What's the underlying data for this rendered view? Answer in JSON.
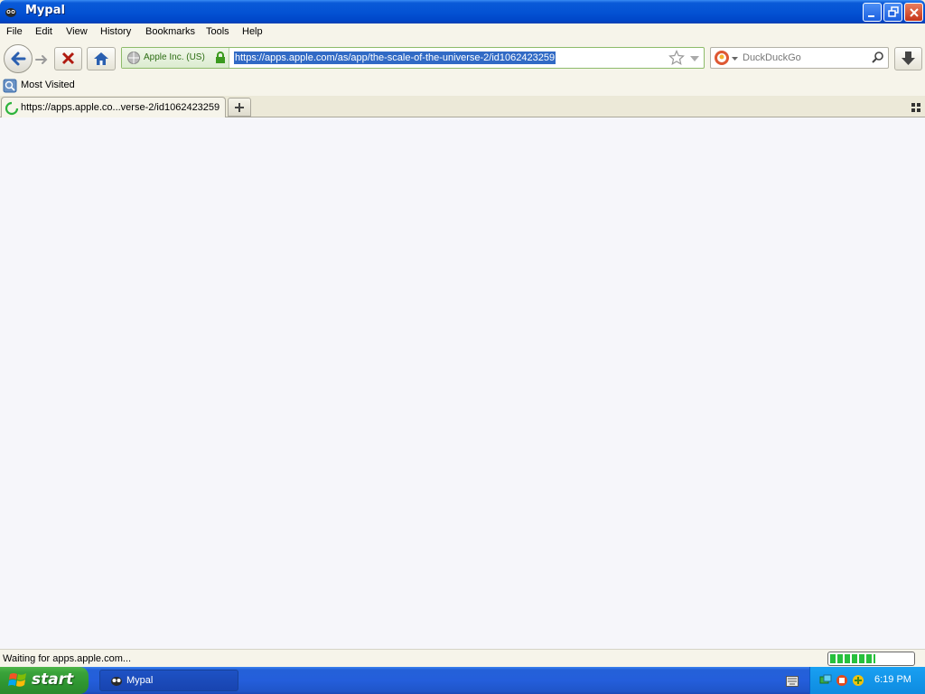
{
  "window": {
    "title": "Mypal"
  },
  "menu": {
    "items": [
      "File",
      "Edit",
      "View",
      "History",
      "Bookmarks",
      "Tools",
      "Help"
    ]
  },
  "navbar": {
    "identity_label": "Apple Inc. (US)",
    "url": "https://apps.apple.com/as/app/the-scale-of-the-universe-2/id1062423259",
    "search_placeholder": "DuckDuckGo"
  },
  "bookmarks": {
    "most_visited": "Most Visited"
  },
  "tabs": [
    {
      "label": "https://apps.apple.co...verse-2/id1062423259",
      "loading": true
    }
  ],
  "status": {
    "text": "Waiting for apps.apple.com...",
    "progress_fraction": 0.55
  },
  "taskbar": {
    "start_label": "start",
    "task_label": "Mypal",
    "clock": "6:19 PM"
  },
  "colors": {
    "title_bar": "#0453d4",
    "selection": "#316ac5",
    "progress": "#27c03d",
    "start_green": "#3aa33a"
  }
}
